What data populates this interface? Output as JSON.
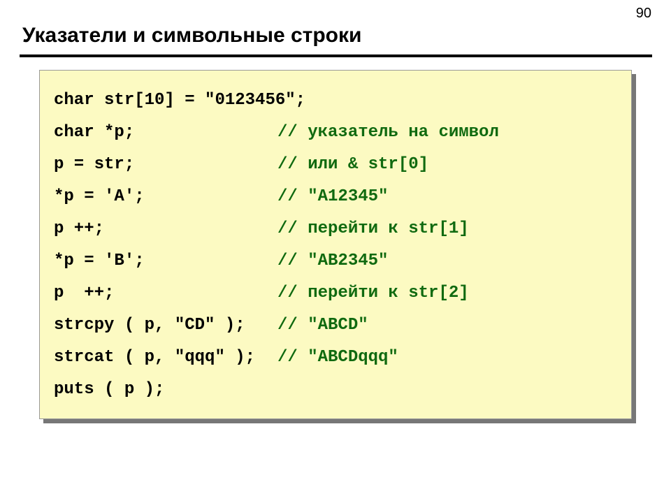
{
  "page_number": "90",
  "title": "Указатели и символьные строки",
  "code": {
    "lines": [
      {
        "stmt": "char str[10] = \"0123456\";",
        "cmt": ""
      },
      {
        "stmt": "char *p;",
        "cmt": "// указатель на символ"
      },
      {
        "stmt": "p = str;",
        "cmt": "// или & str[0]"
      },
      {
        "stmt": "*p = 'A';",
        "cmt": "// \"A12345\""
      },
      {
        "stmt": "p ++;",
        "cmt": "// перейти к str[1]"
      },
      {
        "stmt": "*p = 'B';",
        "cmt": "// \"AB2345\""
      },
      {
        "stmt": "p  ++;",
        "cmt": "// перейти к str[2]"
      },
      {
        "stmt": "strcpy ( p, \"CD\" );",
        "cmt": "// \"ABCD\""
      },
      {
        "stmt": "strcat ( p, \"qqq\" );",
        "cmt": "// \"ABCDqqq\""
      },
      {
        "stmt": "puts ( p );",
        "cmt": ""
      }
    ]
  }
}
